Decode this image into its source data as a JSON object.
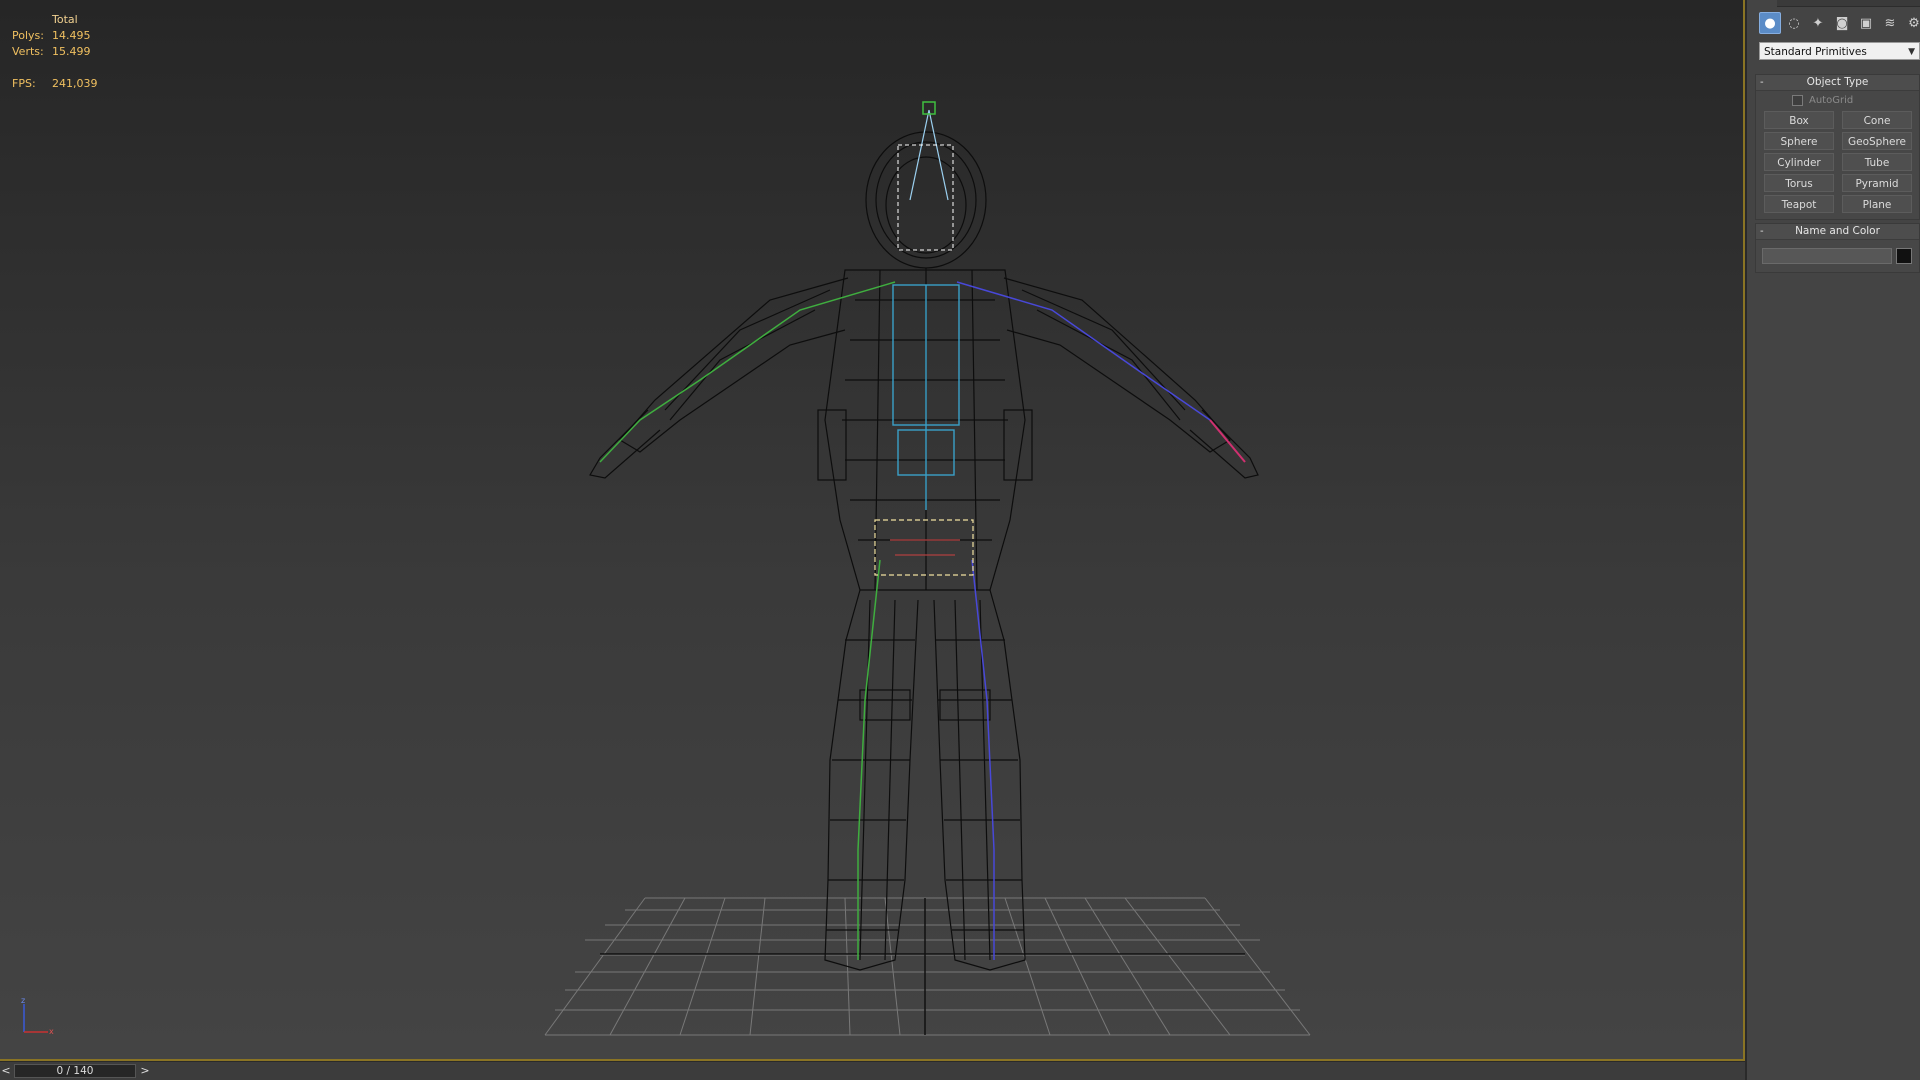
{
  "viewport_stats": {
    "header": "Total",
    "polys_label": "Polys:",
    "polys_value": "14.495",
    "verts_label": "Verts:",
    "verts_value": "15.499",
    "fps_label": "FPS:",
    "fps_value": "241,039"
  },
  "command_panel": {
    "tab_icons": [
      "geometry-icon",
      "shapes-icon",
      "lights-icon",
      "cameras-icon",
      "helpers-icon",
      "spacewarps-icon",
      "systems-icon"
    ],
    "category_dropdown": "Standard Primitives",
    "object_type": {
      "title": "Object Type",
      "collapse": "-",
      "autogrid_label": "AutoGrid",
      "buttons": [
        "Box",
        "Cone",
        "Sphere",
        "GeoSphere",
        "Cylinder",
        "Tube",
        "Torus",
        "Pyramid",
        "Teapot",
        "Plane"
      ]
    },
    "name_and_color": {
      "title": "Name and Color",
      "collapse": "-",
      "name_value": "",
      "swatch_color": "#111111"
    }
  },
  "timeline": {
    "prev": "<",
    "position": "0 / 140",
    "next": ">"
  },
  "colors": {
    "accent_border": "#8a7424",
    "stats_text": "#f0c060",
    "active_tab": "#5b8cc7",
    "bone_left": "#3fae3f",
    "bone_right": "#4848d8",
    "bone_spine": "#3aa0c8"
  }
}
